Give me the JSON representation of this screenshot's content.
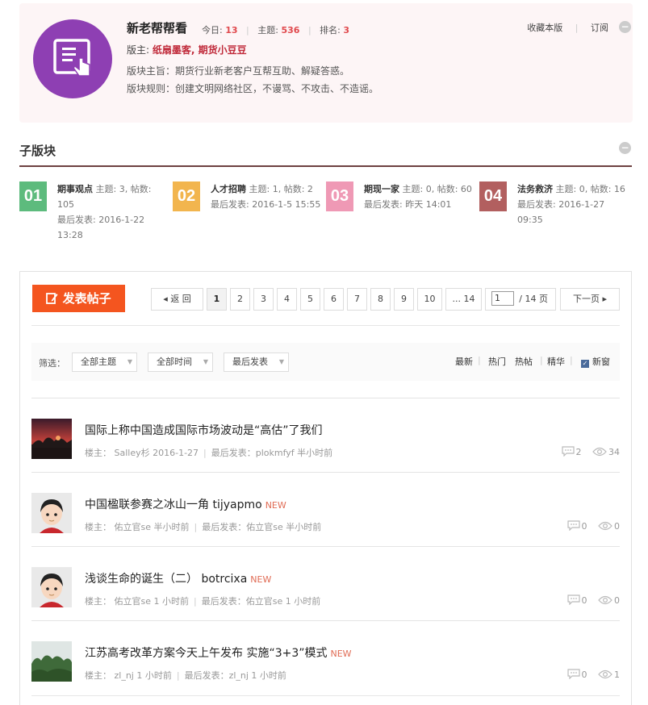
{
  "forum": {
    "title": "新老帮帮看",
    "today_label": "今日:",
    "today_value": "13",
    "topics_label": "主题:",
    "topics_value": "536",
    "rank_label": "排名:",
    "rank_value": "3",
    "favorite": "收藏本版",
    "subscribe": "订阅",
    "moderators_label": "版主:",
    "moderators": "纸扇墨客, 期货小豆豆",
    "purpose": "版块主旨：期货行业新老客户互帮互助、解疑答惑。",
    "rules": "版块规则：创建文明网络社区，不谩骂、不攻击、不造谣。",
    "collapse": "−"
  },
  "subforums": {
    "heading": "子版块",
    "items": [
      {
        "num": "01",
        "name": "期事观点",
        "stats": " 主题: 3, 帖数: 105",
        "last": "最后发表: 2016-1-22 13:28",
        "color": "#5dbb7d"
      },
      {
        "num": "02",
        "name": "人才招聘",
        "stats": " 主题: 1, 帖数: 2",
        "last": "最后发表: 2016-1-5 15:55",
        "color": "#f2b54e"
      },
      {
        "num": "03",
        "name": "期现一家",
        "stats": " 主题: 0, 帖数: 60",
        "last": "最后发表: 昨天 14:01",
        "color": "#ef99b5"
      },
      {
        "num": "04",
        "name": "法务救济",
        "stats": " 主题: 0, 帖数: 16",
        "last": "最后发表: 2016-1-27 09:35",
        "color": "#b25f5f"
      }
    ]
  },
  "toolbar": {
    "post_label": "发表帖子",
    "back": "◂ 返 回",
    "pages": [
      "1",
      "2",
      "3",
      "4",
      "5",
      "6",
      "7",
      "8",
      "9",
      "10",
      "... 14"
    ],
    "current_page": "1",
    "total_pages": "/ 14 页",
    "next": "下一页 ▸"
  },
  "filter": {
    "label": "筛选：",
    "topic": "全部主题",
    "time": "全部时间",
    "sort": "最后发表",
    "latest": "最新",
    "hot": "热门",
    "hotpost": "热帖",
    "digest": "精华",
    "newwin": "新窗"
  },
  "threads": [
    {
      "title": "国际上称中国造成国际市场波动是“高估”了我们",
      "badge": "",
      "author": "楼主： Salley杉 2016-1-27",
      "last": "最后发表：plokmfyf  半小时前",
      "replies": "2",
      "views": "34"
    },
    {
      "title": "中国楹联参赛之冰山一角 tijyapmo",
      "badge": "NEW",
      "author": "楼主： 佑立官se  半小时前",
      "last": "最后发表：佑立官se  半小时前",
      "replies": "0",
      "views": "0"
    },
    {
      "title": "浅谈生命的诞生（二） botrcixa",
      "badge": "NEW",
      "author": "楼主： 佑立官se  1 小时前",
      "last": "最后发表：佑立官se  1 小时前",
      "replies": "0",
      "views": "0"
    },
    {
      "title": "江苏高考改革方案今天上午发布 实施“3+3”模式",
      "badge": "NEW",
      "author": "楼主： zl_nj  1 小时前",
      "last": "最后发表：zl_nj  1 小时前",
      "replies": "0",
      "views": "1"
    }
  ]
}
